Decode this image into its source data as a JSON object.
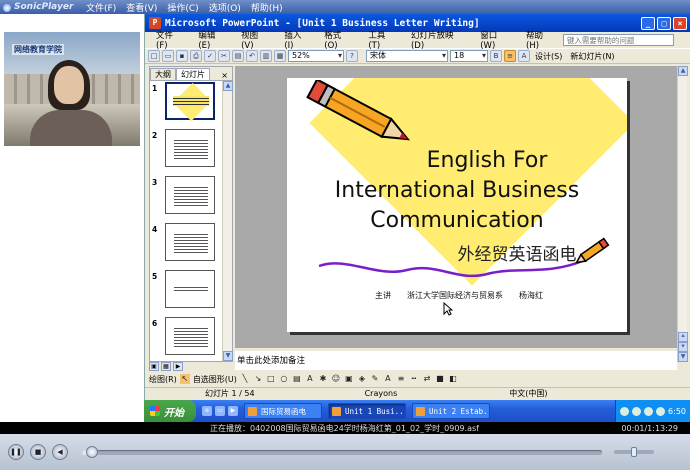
{
  "player": {
    "logo": "SonicPlayer",
    "menu": [
      "文件(F)",
      "查看(V)",
      "操作(C)",
      "选项(O)",
      "帮助(H)"
    ],
    "video_logo": "网络教育学院",
    "now_playing_label": "正在播放：",
    "now_playing_file": "0402008国际贸易函电24学时杨海红第_01_02_学时_0909.asf",
    "time": "00:01/1:13:29",
    "progress": 0.02,
    "volume": 0.5
  },
  "ppt": {
    "title": "Microsoft PowerPoint - [Unit 1 Business Letter Writing]",
    "menu": [
      "文件(F)",
      "编辑(E)",
      "视图(V)",
      "插入(I)",
      "格式(O)",
      "工具(T)",
      "幻灯片放映(D)",
      "窗口(W)",
      "帮助(H)"
    ],
    "help_placeholder": "键入需要帮助的问题",
    "zoom": "52%",
    "font_name": "宋体",
    "font_size": "18",
    "design_label": "设计(S)",
    "new_slide_label": "新幻灯片(N)",
    "tabs": [
      "大纲",
      "幻灯片"
    ],
    "active_tab": 1,
    "thumb_numbers": [
      "1",
      "2",
      "3",
      "4",
      "5",
      "6"
    ],
    "notes_placeholder": "单击此处添加备注",
    "draw_label": "绘图(R)",
    "autoshapes_label": "自选图形(U)",
    "status_slide": "幻灯片 1 / 54",
    "status_design": "Crayons",
    "status_lang": "中文(中国)"
  },
  "slide": {
    "title_lines": [
      "English For",
      "International Business",
      "Communication"
    ],
    "subtitle": "外经贸英语函电",
    "presenter_role": "主讲",
    "presenter_dept": "浙江大学国际经济与贸易系",
    "presenter_name": "杨海红"
  },
  "taskbar": {
    "start": "开始",
    "tasks": [
      "国际贸易函电",
      "Unit 1 Busi...",
      "Unit 2 Estab..."
    ],
    "active_task": 1,
    "clock": "6:50"
  },
  "colors": {
    "slide_yellow": "#ffec70",
    "xp_blue": "#0a58e0",
    "start_green": "#48a84a"
  }
}
